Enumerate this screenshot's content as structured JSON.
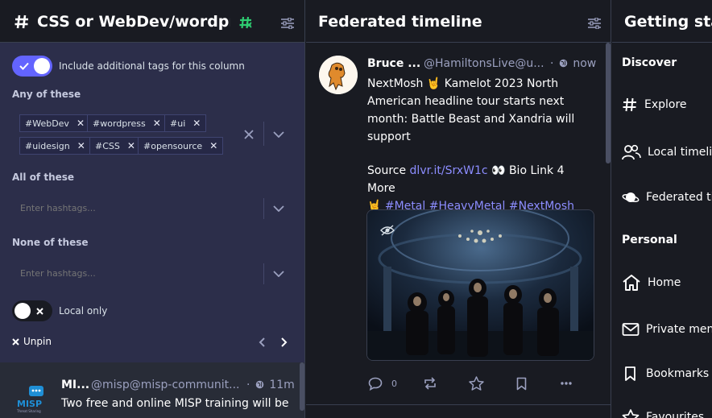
{
  "colors": {
    "accent": "#6364ff",
    "link": "#8c8dff",
    "hashtag_icon": "#2ecc71",
    "panel": "#2c2e4a"
  },
  "col1": {
    "title": "CSS or WebDev/wordpr...",
    "header_icon": "hashtag-icon",
    "settings_icon": "sliders-icon",
    "include_tags_label": "Include additional tags for this column",
    "include_tags_on": true,
    "any_label": "Any of these",
    "any_tags": [
      "#WebDev",
      "#wordpress",
      "#ui",
      "#uidesign",
      "#CSS",
      "#opensource"
    ],
    "all_label": "All of these",
    "all_placeholder": "Enter hashtags...",
    "none_label": "None of these",
    "none_placeholder": "Enter hashtags...",
    "local_only_label": "Local only",
    "local_only_on": false,
    "unpin_label": "Unpin",
    "status": {
      "name": "MI...",
      "handle": "@misp@misp-communit...",
      "time": "11m",
      "text": "Two free and online MISP training will be"
    }
  },
  "col2": {
    "title": "Federated timeline",
    "status": {
      "name": "Bruce ...",
      "handle": "@HamiltonsLive@u...",
      "time": "now",
      "line1": "NextMosh 🤘 Kamelot 2023 North American headline tour starts next month: Battle Beast and Xandria will support",
      "source_prefix": "Source ",
      "source_link": "dlvr.it/SrxW1c",
      "source_suffix": " 👀 Bio Link 4 More",
      "tags_prefix": "🤘 ",
      "tags": [
        "#Metal",
        "#HeavyMetal",
        "#NextMosh"
      ],
      "reply_count": "0"
    }
  },
  "col3": {
    "title": "Getting started",
    "discover": "Discover",
    "explore": "Explore",
    "local": "Local timeline",
    "federated": "Federated timeline",
    "personal": "Personal",
    "home": "Home",
    "mentions": "Private mentions",
    "bookmarks": "Bookmarks",
    "favourites": "Favourites"
  }
}
